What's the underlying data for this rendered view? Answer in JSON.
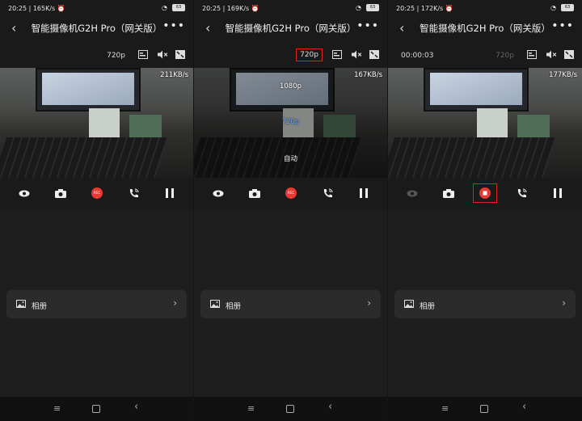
{
  "panels": [
    {
      "status": {
        "time": "20:25",
        "speed": "165K/s"
      },
      "title": "智能摄像机G2H Pro（网关版）",
      "toolbar": {
        "timer": "",
        "resolution": "720p"
      },
      "video": {
        "rate": "211KB/s"
      },
      "rec_label": "REC",
      "album_label": "相册"
    },
    {
      "status": {
        "time": "20:25",
        "speed": "169K/s"
      },
      "title": "智能摄像机G2H Pro（网关版）",
      "toolbar": {
        "timer": "",
        "resolution": "720p"
      },
      "video": {
        "rate": "167KB/s"
      },
      "resolution_menu": {
        "options": [
          "1080p",
          "720p",
          "自动"
        ],
        "selected": "720p"
      },
      "rec_label": "REC",
      "album_label": "相册"
    },
    {
      "status": {
        "time": "20:25",
        "speed": "172K/s"
      },
      "title": "智能摄像机G2H Pro（网关版）",
      "toolbar": {
        "timer": "00:00:03",
        "resolution": "720p"
      },
      "video": {
        "rate": "177KB/s"
      },
      "album_label": "相册"
    }
  ],
  "battery": "63",
  "icons": {
    "back": "chevron-left-icon",
    "more": "more-dots-icon",
    "subtitles": "subtitles-icon",
    "mute": "speaker-muted-icon",
    "fullscreen": "fullscreen-icon",
    "eye": "eye-icon",
    "camera": "camera-icon",
    "call": "phone-call-icon",
    "pause": "pause-icon",
    "stop": "stop-record-icon",
    "album": "image-icon",
    "chevron": "chevron-right-icon"
  },
  "colors": {
    "highlight": "#e02020",
    "record": "#e53935",
    "selected": "#5ea2ff",
    "background": "#1a1a1a"
  }
}
